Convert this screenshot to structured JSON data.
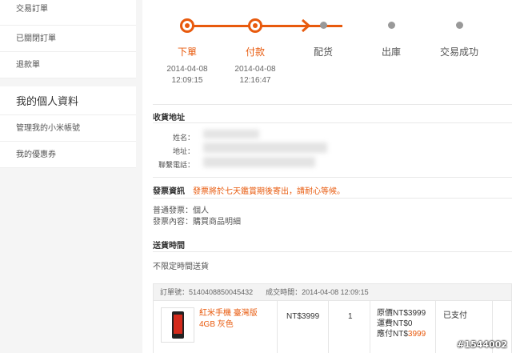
{
  "sidebar": {
    "orders": [
      {
        "label": "交易訂單"
      },
      {
        "label": "已關閉訂單"
      },
      {
        "label": "退款單"
      }
    ],
    "profile_title": "我的個人資料",
    "profile_items": [
      {
        "label": "管理我的小米帳號"
      },
      {
        "label": "我的優惠券"
      }
    ]
  },
  "progress": {
    "steps": [
      {
        "label": "下單",
        "date": "2014-04-08",
        "time": "12:09:15",
        "state": "done"
      },
      {
        "label": "付款",
        "date": "2014-04-08",
        "time": "12:16:47",
        "state": "done"
      },
      {
        "label": "配货",
        "state": "pending"
      },
      {
        "label": "出庫",
        "state": "pending"
      },
      {
        "label": "交易成功",
        "state": "pending"
      }
    ],
    "accent_color": "#e85a0d",
    "pending_color": "#999999"
  },
  "shipping": {
    "title": "收貨地址",
    "name_label": "姓名：",
    "address_label": "地址：",
    "phone_label": "聯繫電話："
  },
  "invoice": {
    "title": "發票資訊",
    "note": "發票將於七天鑑賞期後寄出，請耐心等候。",
    "type_line": "普通發票：個人",
    "content_line": "發票內容：購買商品明細"
  },
  "delivery": {
    "title": "送貨時間",
    "value": "不限定時間送貨"
  },
  "order": {
    "number_text": "訂單號：5140408850045432",
    "time_text": "成交時間：2014-04-08 12:09:15",
    "item": {
      "name_line1": "紅米手機 臺灣版",
      "name_line2": "4GB 灰色",
      "price": "NT$3999",
      "quantity": "1",
      "original_label": "原價NT$3999",
      "shipping_label": "運費NT$0",
      "payable_prefix": "應付NT$",
      "payable_value": "3999",
      "status": "已支付"
    }
  },
  "watermark": "#1544002"
}
